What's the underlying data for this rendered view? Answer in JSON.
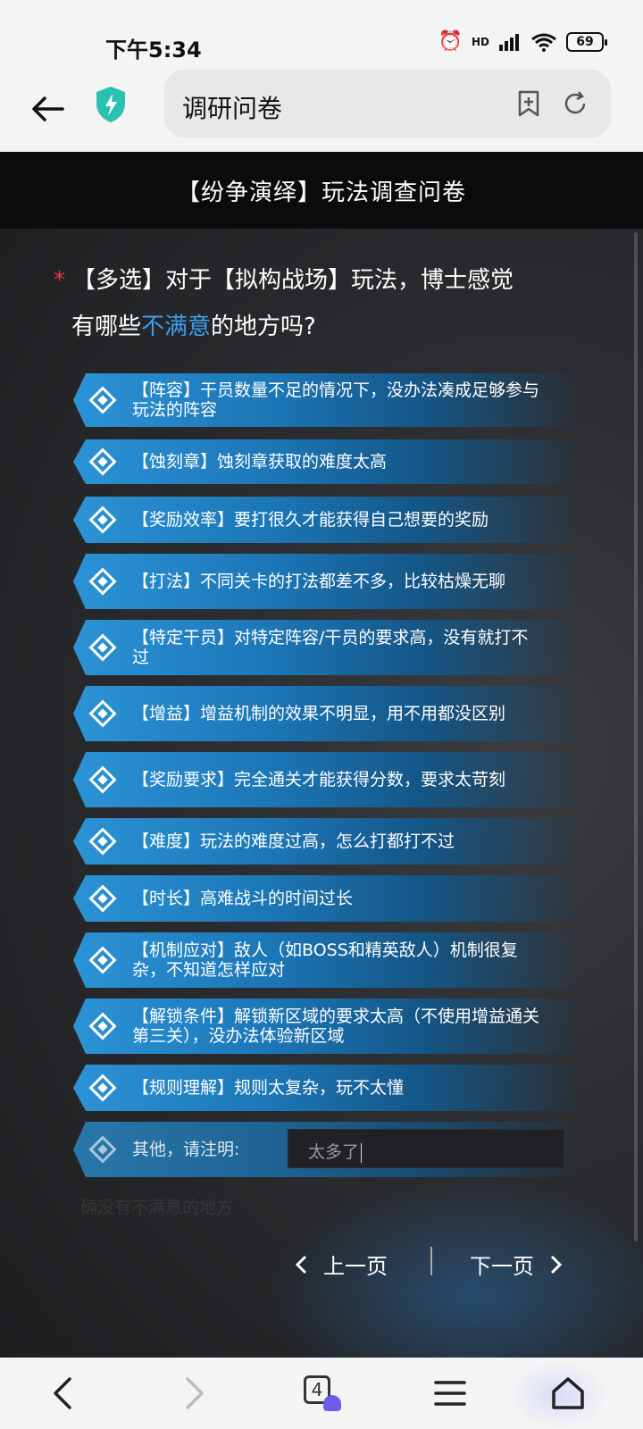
{
  "status": {
    "time": "下午5:34",
    "battery": "69",
    "network_label": "HD"
  },
  "browser": {
    "url_text": "调研问卷"
  },
  "page": {
    "title": "【纷争演绎】玩法调查问卷",
    "question": {
      "required_mark": "*",
      "part1": "【多选】对于【拟构战场】玩法，博士感觉",
      "part2": "有哪些",
      "highlight": "不满意",
      "part3": "的地方吗?"
    },
    "options": [
      "【阵容】干员数量不足的情况下，没办法凑成足够参与玩法的阵容",
      "【蚀刻章】蚀刻章获取的难度太高",
      "【奖励效率】要打很久才能获得自己想要的奖励",
      "【打法】不同关卡的打法都差不多，比较枯燥无聊",
      "【特定干员】对特定阵容/干员的要求高，没有就打不过",
      "【增益】增益机制的效果不明显，用不用都没区别",
      "【奖励要求】完全通关才能获得分数，要求太苛刻",
      "【难度】玩法的难度过高，怎么打都打不过",
      "【时长】高难战斗的时间过长",
      "【机制应对】敌人（如BOSS和精英敌人）机制很复杂，不知道怎样应对",
      "【解锁条件】解锁新区域的要求太高（不使用增益通关第三关），没办法体验新区域",
      "【规则理解】规则太复杂，玩不太懂"
    ],
    "other": {
      "label": "其他，请注明:",
      "value": "太多了"
    },
    "faded_option": "确没有不满意的地方",
    "pager": {
      "prev": "上一页",
      "next": "下一页"
    }
  },
  "bottom_nav": {
    "tab_count": "4"
  }
}
